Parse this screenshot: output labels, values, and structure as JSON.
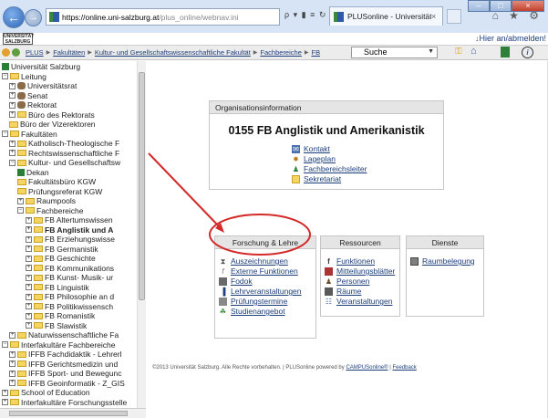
{
  "browser": {
    "url_domain": "https://online.uni-salzburg.at",
    "url_path": "/plus_online/webnav.ini",
    "addr_tools": "ρ ▾ ▮ ≡ ↻ ×",
    "tab_label": "PLUSonline - Universität Sa...",
    "tab_close": "×",
    "window_buttons": [
      "–",
      "□",
      "×"
    ],
    "icons": "⌂ ★ ⚙"
  },
  "site_header": {
    "logo_text": "UNIVERSITÄT SALZBURG",
    "login_link": "Hier an/abmelden!"
  },
  "toolbar": {
    "breadcrumb": [
      "PLUS",
      "Fakultäten",
      "Kultur- und Gesellschaftswissenschaftliche Fakultät",
      "Fachbereiche",
      "FB"
    ],
    "search_label": "Suche"
  },
  "tree": [
    {
      "label": "Universität Salzburg",
      "level": 0,
      "icon": "green",
      "box": ""
    },
    {
      "label": "Leitung",
      "level": 0,
      "icon": "folder",
      "box": "−"
    },
    {
      "label": "Universitätsrat",
      "level": 1,
      "icon": "people",
      "box": "+"
    },
    {
      "label": "Senat",
      "level": 1,
      "icon": "people",
      "box": "+"
    },
    {
      "label": "Rektorat",
      "level": 1,
      "icon": "people",
      "box": "+"
    },
    {
      "label": "Büro des Rektorats",
      "level": 1,
      "icon": "folder",
      "box": "+"
    },
    {
      "label": "Büro der Vizerektoren",
      "level": 1,
      "icon": "folder",
      "box": ""
    },
    {
      "label": "Fakultäten",
      "level": 0,
      "icon": "folder",
      "box": "−"
    },
    {
      "label": "Katholisch-Theologische F",
      "level": 1,
      "icon": "folder",
      "box": "+"
    },
    {
      "label": "Rechtswissenschaftliche F",
      "level": 1,
      "icon": "folder",
      "box": "+"
    },
    {
      "label": "Kultur- und Gesellschaftsw",
      "level": 1,
      "icon": "folder",
      "box": "−"
    },
    {
      "label": "Dekan",
      "level": 2,
      "icon": "green",
      "box": ""
    },
    {
      "label": "Fakultätsbüro KGW",
      "level": 2,
      "icon": "folder",
      "box": ""
    },
    {
      "label": "Prüfungsreferat KGW",
      "level": 2,
      "icon": "folder",
      "box": ""
    },
    {
      "label": "Raumpools",
      "level": 2,
      "icon": "folder",
      "box": "+"
    },
    {
      "label": "Fachbereiche",
      "level": 2,
      "icon": "folder",
      "box": "−"
    },
    {
      "label": "FB Altertumswissen",
      "level": 3,
      "icon": "folder",
      "box": "+"
    },
    {
      "label": "FB Anglistik und A",
      "level": 3,
      "icon": "folder",
      "box": "+",
      "bold": true
    },
    {
      "label": "FB Erziehungswisse",
      "level": 3,
      "icon": "folder",
      "box": "+"
    },
    {
      "label": "FB Germanistik",
      "level": 3,
      "icon": "folder",
      "box": "+"
    },
    {
      "label": "FB Geschichte",
      "level": 3,
      "icon": "folder",
      "box": "+"
    },
    {
      "label": "FB Kommunikations",
      "level": 3,
      "icon": "folder",
      "box": "+"
    },
    {
      "label": "FB Kunst- Musik- ur",
      "level": 3,
      "icon": "folder",
      "box": "+"
    },
    {
      "label": "FB Linguistik",
      "level": 3,
      "icon": "folder",
      "box": "+"
    },
    {
      "label": "FB Philosophie an d",
      "level": 3,
      "icon": "folder",
      "box": "+"
    },
    {
      "label": "FB Politikwissensch",
      "level": 3,
      "icon": "folder",
      "box": "+"
    },
    {
      "label": "FB Romanistik",
      "level": 3,
      "icon": "folder",
      "box": "+"
    },
    {
      "label": "FB Slawistik",
      "level": 3,
      "icon": "folder",
      "box": "+"
    },
    {
      "label": "Naturwissenschaftliche Fa",
      "level": 1,
      "icon": "folder",
      "box": "+"
    },
    {
      "label": "Interfakultäre Fachbereiche",
      "level": 0,
      "icon": "folder",
      "box": "−"
    },
    {
      "label": "IFFB Fachdidaktik - Lehrerl",
      "level": 1,
      "icon": "folder",
      "box": "+"
    },
    {
      "label": "IFFB Gerichtsmedizin und",
      "level": 1,
      "icon": "folder",
      "box": "+"
    },
    {
      "label": "IFFB Sport- und Bewegunc",
      "level": 1,
      "icon": "folder",
      "box": "+"
    },
    {
      "label": "IFFB Geoinformatik - Z_GIS",
      "level": 1,
      "icon": "folder",
      "box": "+"
    },
    {
      "label": "School of Education",
      "level": 0,
      "icon": "folder",
      "box": "+"
    },
    {
      "label": "Interfakultäre Forschungsstelle",
      "level": 0,
      "icon": "folder",
      "box": "+"
    }
  ],
  "org_box": {
    "header": "Organisationsinformation",
    "title": "0155 FB Anglistik und Amerikanistik",
    "links": [
      "Kontakt",
      "Lageplan",
      "Fachbereichsleiter",
      "Sekretariat"
    ]
  },
  "forschung_box": {
    "header": "Forschung & Lehre",
    "links": [
      "Auszeichnungen",
      "Externe Funktionen",
      "Fodok",
      "Lehrveranstaltungen",
      "Prüfungstermine",
      "Studienangebot"
    ]
  },
  "ressourcen_box": {
    "header": "Ressourcen",
    "links": [
      "Funktionen",
      "Mitteilungsblätter",
      "Personen",
      "Räume",
      "Veranstaltungen"
    ]
  },
  "dienste_box": {
    "header": "Dienste",
    "links": [
      "Raumbelegung"
    ]
  },
  "footer": {
    "text": "©2013 Universität Salzburg. Alle Rechte vorbehalten. | PLUSonline powered by ",
    "link1": "CAMPUSonline®",
    "sep": " | ",
    "link2": "Feedback"
  },
  "colors": {
    "annotation": "#d42a2a",
    "link": "#1c3e7a"
  }
}
